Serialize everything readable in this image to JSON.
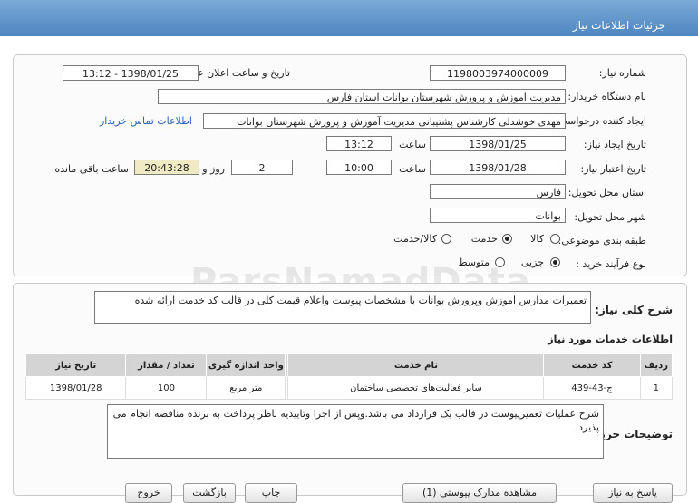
{
  "header": {
    "title": "جزئیات اطلاعات نیاز"
  },
  "form": {
    "need_number_label": "شماره نیاز:",
    "need_number": "1198003974000009",
    "announce_label": "تاریخ و ساعت اعلان عمومی:",
    "announce_value": "1398/01/25 - 13:12",
    "buyer_org_label": "نام دستگاه خریدار:",
    "buyer_org": "مدیریت آموزش و پرورش شهرستان بوانات استان فارس",
    "requester_label": "ایجاد کننده درخواست:",
    "requester": "مهدی خوشدلی کارشناس پشتیبانی مدیریت آموزش و پرورش شهرستان بوانات",
    "contact_link": "اطلاعات تماس خریدار",
    "created_label": "تاریخ ایجاد نیاز:",
    "created_date": "1398/01/25",
    "time_word": "ساعت",
    "created_time": "13:12",
    "validity_label": "تاریخ اعتبار نیاز:",
    "validity_date": "1398/01/28",
    "validity_time": "10:00",
    "days": "2",
    "days_word": "روز و",
    "remaining_time": "20:43:28",
    "remaining_word": "ساعت باقی مانده",
    "province_label": "استان محل تحویل:",
    "province": "فارس",
    "city_label": "شهر محل تحویل:",
    "city": "بوانات",
    "category_label": "طبقه بندی موضوعی:",
    "category_options": [
      "کالا",
      "خدمت",
      "کالا/خدمت"
    ],
    "process_label": "نوع فرآیند خرید :",
    "process_options": [
      "جزیی",
      "متوسط"
    ]
  },
  "watermark": "ParsNamadData",
  "summary": {
    "label": "شرح کلی نیاز:",
    "text": "تعمیرات مدارس آموزش وپرورش بوانات با مشخصات پیوست واعلام قیمت کلی در قالب کد خدمت ارائه شده"
  },
  "services": {
    "title": "اطلاعات خدمات مورد نیاز",
    "columns": [
      "ردیف",
      "کد خدمت",
      "نام خدمت",
      "واحد اندازه گیری",
      "تعداد / مقدار",
      "تاریخ نیاز"
    ],
    "rows": [
      [
        "1",
        "ج-43-439",
        "سایر فعالیت‌های تخصصی ساختمان",
        "متر مربع",
        "100",
        "1398/01/28"
      ]
    ]
  },
  "buyer_notes": {
    "label": "توضیحات خریدار:",
    "text": "شرح عملیات تعمیرپیوست در قالب یک قرارداد می باشد.وپس از اجرا وتاییدیه ناظر پرداخت به برنده مناقصه انجام می پذیرد."
  },
  "buttons": {
    "reply": "پاسخ به نیاز",
    "view_docs": "مشاهده مدارک پیوستی (1)",
    "print": "چاپ",
    "back": "بازگشت",
    "exit": "خروج"
  },
  "colors": {
    "header": "#5b8fc8",
    "link": "#2a63b8",
    "highlight": "#efe9c4"
  }
}
